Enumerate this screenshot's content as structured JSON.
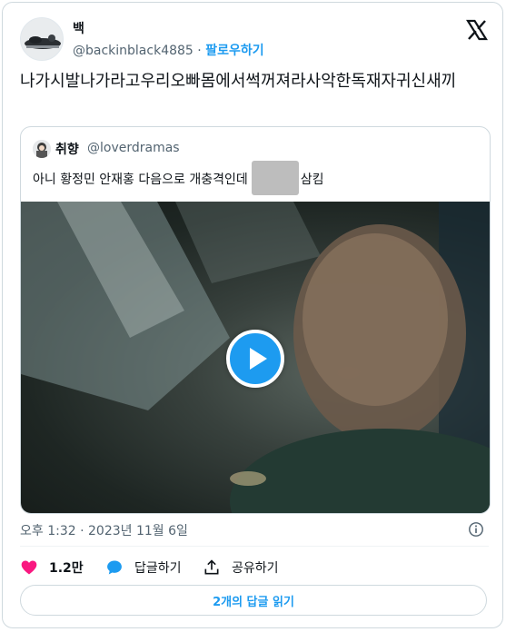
{
  "author": {
    "display_name": "백",
    "handle": "@backinblack4885",
    "separator": "·",
    "follow_label": "팔로우하기"
  },
  "tweet": {
    "text": "나가시발나가라고우리오빠몸에서썩꺼져라사악한독재자귀신새끼"
  },
  "quote": {
    "display_name": "취향",
    "handle": "@loverdramas",
    "text_before": "아니 황정민 안재홍 다음으로 개충격인데",
    "text_after": "삼킴"
  },
  "timestamp": "오후 1:32 · 2023년 11월 6일",
  "actions": {
    "like_count": "1.2만",
    "reply_label": "답글하기",
    "share_label": "공유하기"
  },
  "read_replies_label": "2개의 답글 읽기",
  "colors": {
    "accent": "#1d9bf0",
    "like": "#f91880",
    "secondary_text": "#536471"
  },
  "icons": [
    "x-logo-icon",
    "play-icon",
    "info-icon",
    "heart-icon",
    "reply-bubble-icon",
    "share-icon"
  ]
}
